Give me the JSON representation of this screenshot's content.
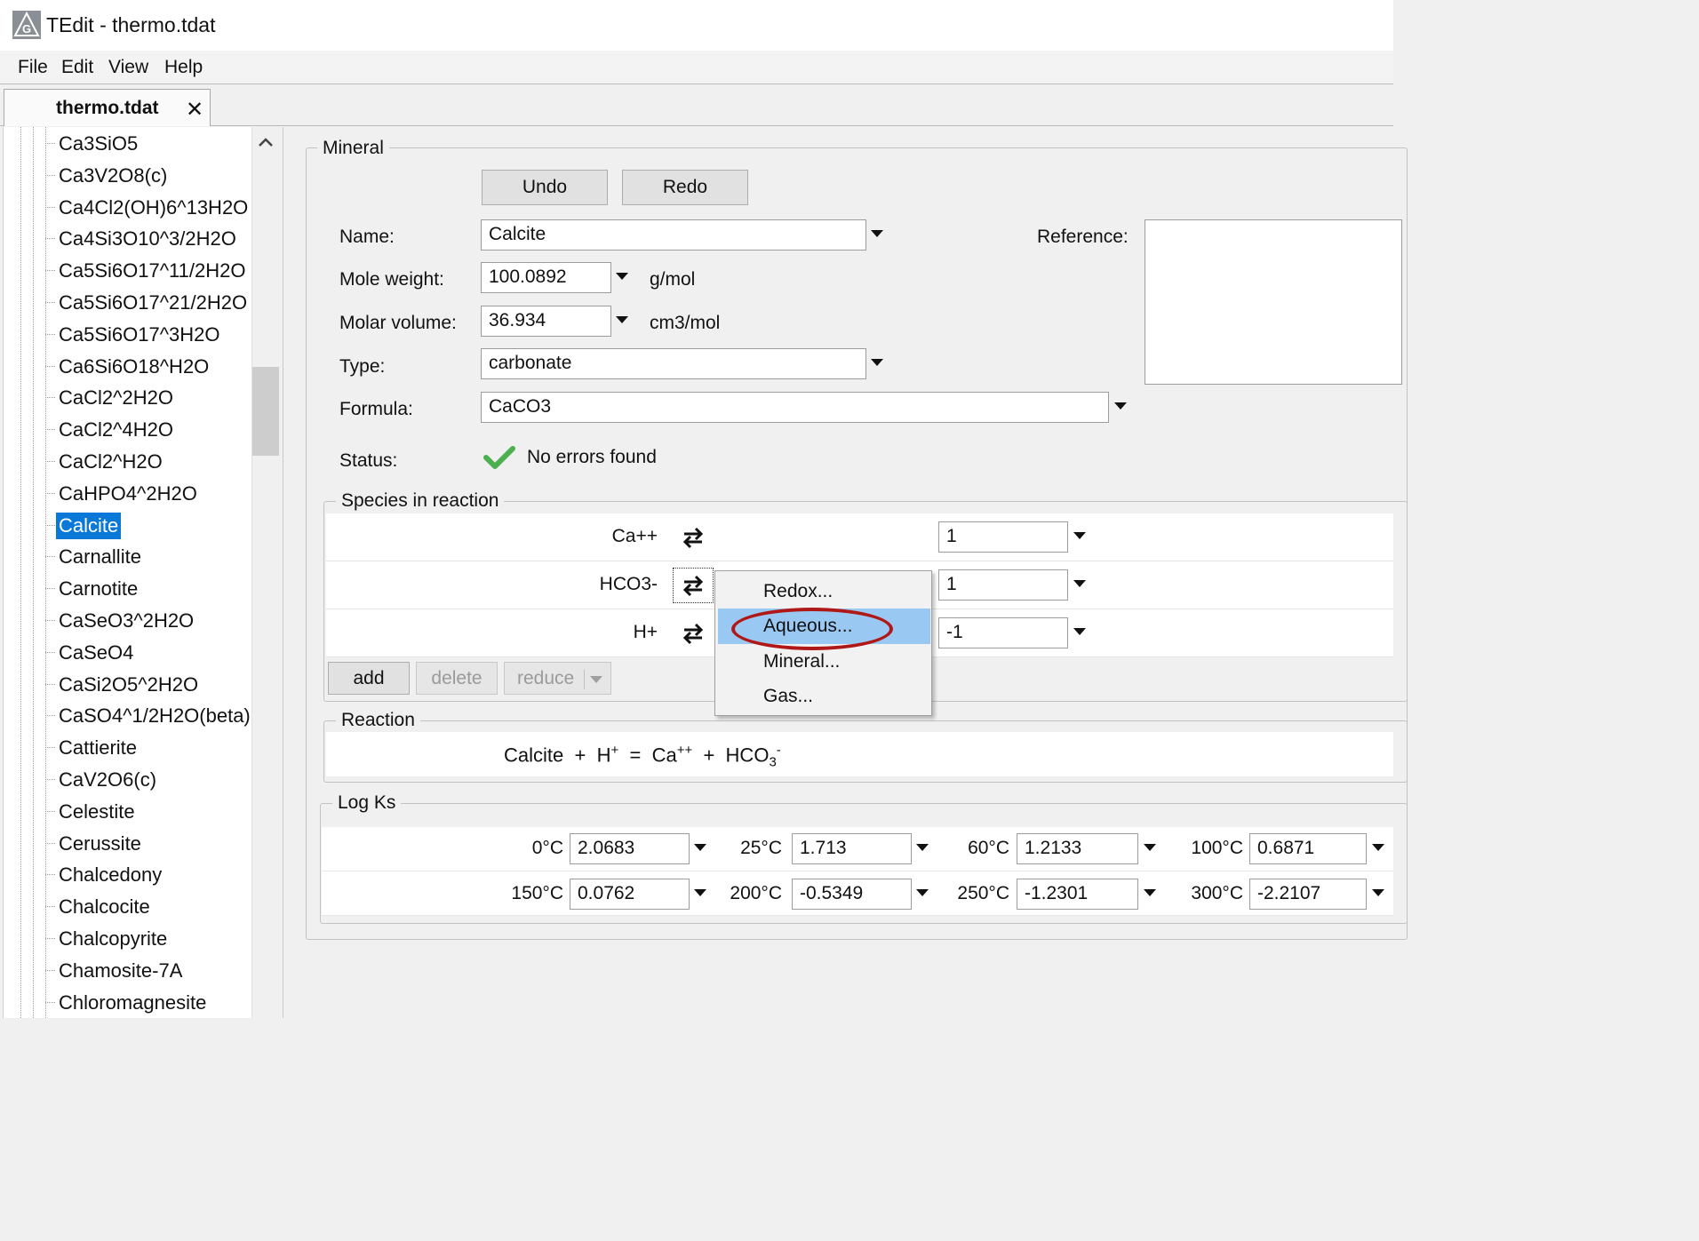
{
  "window": {
    "title": "TEdit - thermo.tdat"
  },
  "menu": [
    "File",
    "Edit",
    "View",
    "Help"
  ],
  "tab": {
    "label": "thermo.tdat",
    "close": "✕"
  },
  "tree": {
    "items": [
      "Ca3SiO5",
      "Ca3V2O8(c)",
      "Ca4Cl2(OH)6^13H2O",
      "Ca4Si3O10^3/2H2O",
      "Ca5Si6O17^11/2H2O",
      "Ca5Si6O17^21/2H2O",
      "Ca5Si6O17^3H2O",
      "Ca6Si6O18^H2O",
      "CaCl2^2H2O",
      "CaCl2^4H2O",
      "CaCl2^H2O",
      "CaHPO4^2H2O",
      "Calcite",
      "Carnallite",
      "Carnotite",
      "CaSeO3^2H2O",
      "CaSeO4",
      "CaSi2O5^2H2O",
      "CaSO4^1/2H2O(beta)",
      "Cattierite",
      "CaV2O6(c)",
      "Celestite",
      "Cerussite",
      "Chalcedony",
      "Chalcocite",
      "Chalcopyrite",
      "Chamosite-7A",
      "Chloromagnesite"
    ],
    "selected": "Calcite"
  },
  "mineral": {
    "group_title": "Mineral",
    "undo": "Undo",
    "redo": "Redo",
    "name_label": "Name:",
    "name_value": "Calcite",
    "reference_label": "Reference:",
    "mole_weight_label": "Mole weight:",
    "mole_weight_value": "100.0892",
    "mole_weight_unit": "g/mol",
    "molar_volume_label": "Molar volume:",
    "molar_volume_value": "36.934",
    "molar_volume_unit": "cm3/mol",
    "type_label": "Type:",
    "type_value": "carbonate",
    "formula_label": "Formula:",
    "formula_value": "CaCO3",
    "status_label": "Status:",
    "status_text": "No errors found",
    "status_color": "#4caf50"
  },
  "species": {
    "group_title": "Species in reaction",
    "rows": [
      {
        "name": "Ca++",
        "coef": "1"
      },
      {
        "name": "HCO3-",
        "coef": "1"
      },
      {
        "name": "H+",
        "coef": "-1"
      }
    ],
    "add": "add",
    "delete": "delete",
    "reduce": "reduce"
  },
  "context_menu": {
    "items": [
      "Redox...",
      "Aqueous...",
      "Mineral...",
      "Gas..."
    ],
    "highlighted": "Aqueous...",
    "highlight_color": "#99c9f2",
    "annotation_color": "#b01818"
  },
  "reaction": {
    "group_title": "Reaction",
    "lhs1": "Calcite",
    "plus1": "+",
    "lhs2_base": "H",
    "lhs2_sup": "+",
    "eq": "=",
    "rhs1_base": "Ca",
    "rhs1_sup": "++",
    "plus2": "+",
    "rhs2_base": "HCO",
    "rhs2_sub": "3",
    "rhs2_sup": "-"
  },
  "logks": {
    "group_title": "Log Ks",
    "rows": [
      [
        {
          "temp": "0°C",
          "value": "2.0683"
        },
        {
          "temp": "25°C",
          "value": "1.713"
        },
        {
          "temp": "60°C",
          "value": "1.2133"
        },
        {
          "temp": "100°C",
          "value": "0.6871"
        }
      ],
      [
        {
          "temp": "150°C",
          "value": "0.0762"
        },
        {
          "temp": "200°C",
          "value": "-0.5349"
        },
        {
          "temp": "250°C",
          "value": "-1.2301"
        },
        {
          "temp": "300°C",
          "value": "-2.2107"
        }
      ]
    ]
  }
}
